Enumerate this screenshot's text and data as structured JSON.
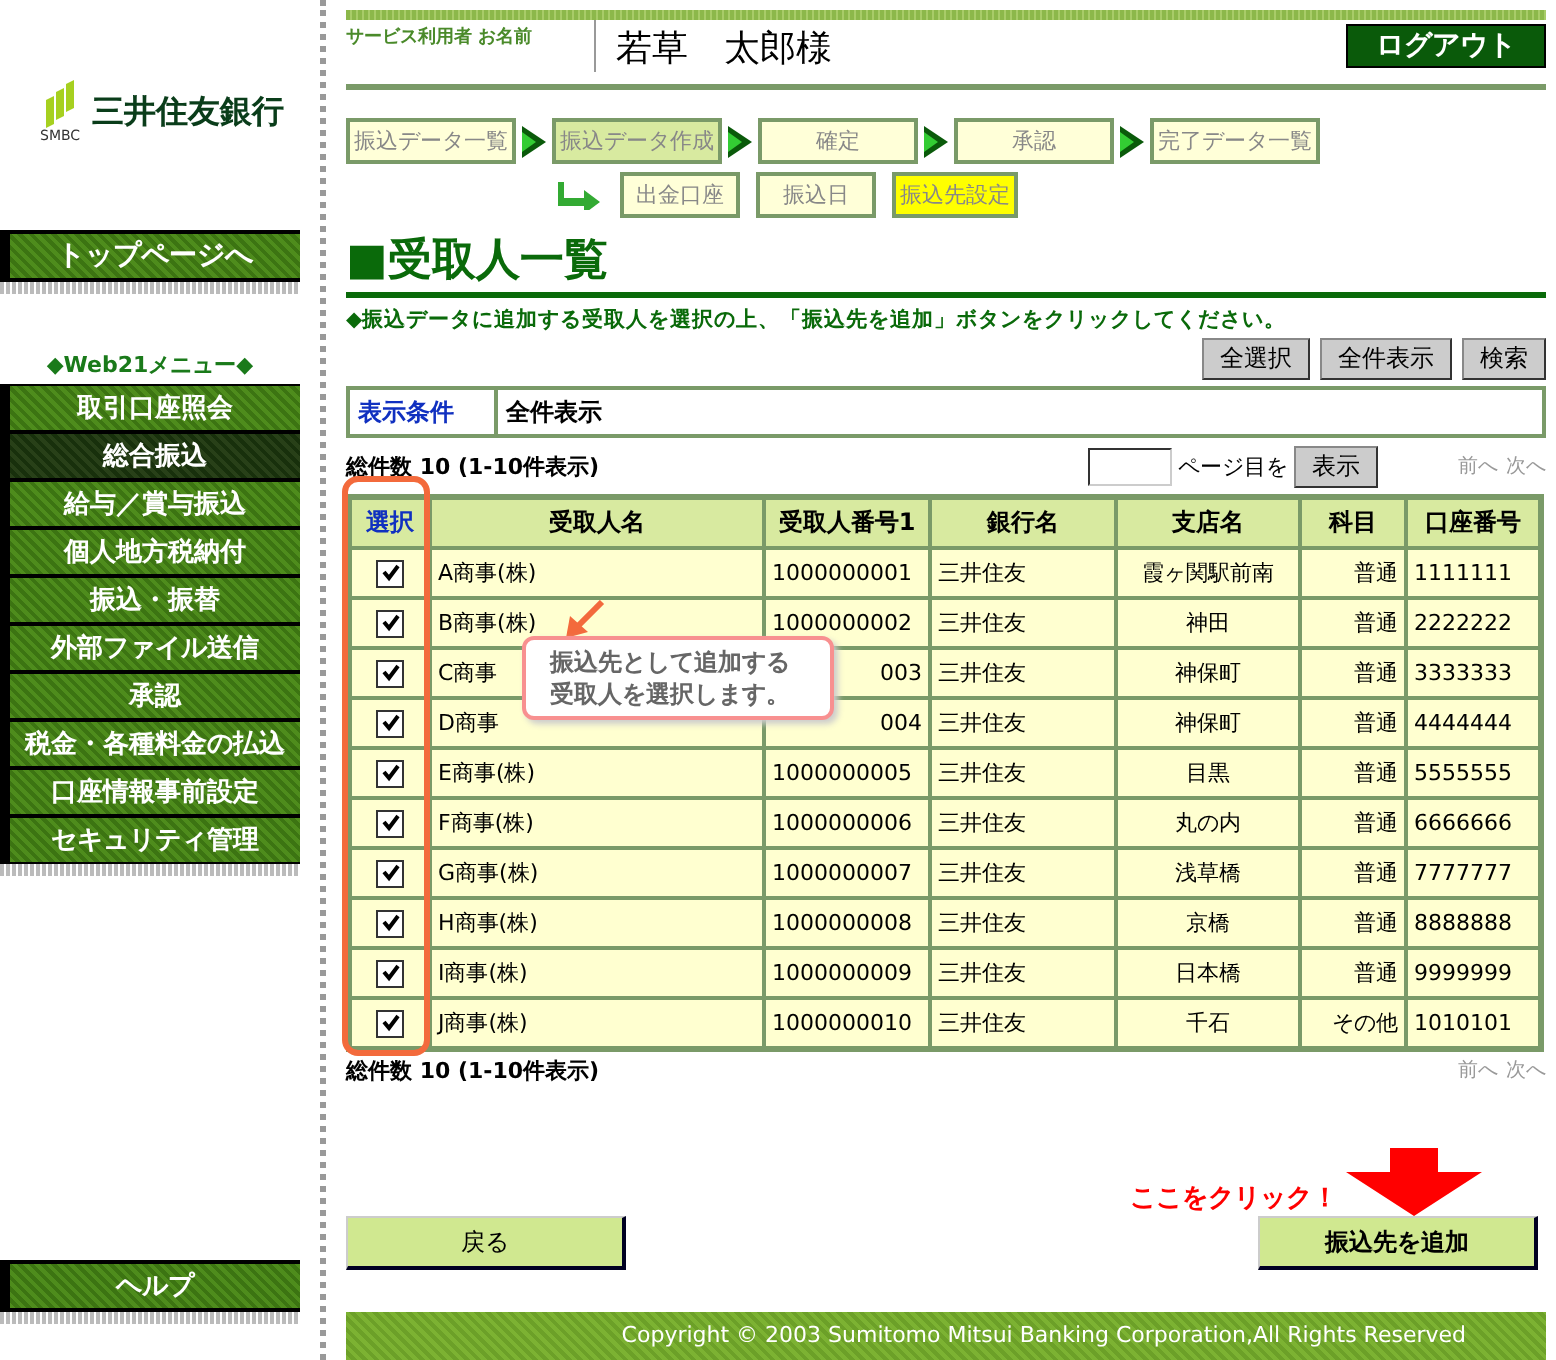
{
  "sidebar": {
    "logo_text": "三井住友銀行",
    "logo_sub": "SMBC",
    "top_button": "トップページへ",
    "menu_title": "◆Web21メニュー◆",
    "items": [
      {
        "label": "取引口座照会",
        "selected": false
      },
      {
        "label": "総合振込",
        "selected": true
      },
      {
        "label": "給与／賞与振込",
        "selected": false
      },
      {
        "label": "個人地方税納付",
        "selected": false
      },
      {
        "label": "振込・振替",
        "selected": false
      },
      {
        "label": "外部ファイル送信",
        "selected": false
      },
      {
        "label": "承認",
        "selected": false
      },
      {
        "label": "税金・各種料金の払込",
        "selected": false
      },
      {
        "label": "口座情報事前設定",
        "selected": false
      },
      {
        "label": "セキュリティ管理",
        "selected": false
      }
    ],
    "help_button": "ヘルプ"
  },
  "header": {
    "user_label": "サービス利用者 お名前",
    "user_name": "若草　太郎様",
    "logout": "ログアウト"
  },
  "steps": [
    {
      "label": "振込データ一覧",
      "selected": false
    },
    {
      "label": "振込データ作成",
      "selected": true
    },
    {
      "label": "確定",
      "selected": false
    },
    {
      "label": "承認",
      "selected": false
    },
    {
      "label": "完了データ一覧",
      "selected": false
    }
  ],
  "substeps": [
    {
      "label": "出金口座",
      "selected": false
    },
    {
      "label": "振込日",
      "selected": false
    },
    {
      "label": "振込先設定",
      "selected": true
    }
  ],
  "title": "■受取人一覧",
  "instruction": "◆振込データに追加する受取人を選択の上、「振込先を追加」ボタンをクリックしてください。",
  "toolbar": [
    "全選択",
    "全件表示",
    "検索"
  ],
  "condition": {
    "label": "表示条件",
    "value": "全件表示"
  },
  "count_text": "総件数 10 (1-10件表示)",
  "page_suffix": "ページ目を",
  "page_button": "表示",
  "pager": [
    "前へ",
    "次へ"
  ],
  "table": {
    "select_header": "選択",
    "columns": [
      "受取人名",
      "受取人番号1",
      "銀行名",
      "支店名",
      "科目",
      "口座番号"
    ],
    "rows": [
      {
        "checked": true,
        "covered": false,
        "cells": [
          "A商事(株)",
          "1000000001",
          "三井住友",
          "霞ヶ関駅前南",
          "普通",
          "1111111"
        ]
      },
      {
        "checked": true,
        "covered": false,
        "cells": [
          "B商事(株)",
          "1000000002",
          "三井住友",
          "神田",
          "普通",
          "2222222"
        ]
      },
      {
        "checked": true,
        "covered": true,
        "cells": [
          "C商事",
          "003",
          "三井住友",
          "神保町",
          "普通",
          "3333333"
        ]
      },
      {
        "checked": true,
        "covered": true,
        "cells": [
          "D商事",
          "004",
          "三井住友",
          "神保町",
          "普通",
          "4444444"
        ]
      },
      {
        "checked": true,
        "covered": false,
        "cells": [
          "E商事(株)",
          "1000000005",
          "三井住友",
          "目黒",
          "普通",
          "5555555"
        ]
      },
      {
        "checked": true,
        "covered": false,
        "cells": [
          "F商事(株)",
          "1000000006",
          "三井住友",
          "丸の内",
          "普通",
          "6666666"
        ]
      },
      {
        "checked": true,
        "covered": false,
        "cells": [
          "G商事(株)",
          "1000000007",
          "三井住友",
          "浅草橋",
          "普通",
          "7777777"
        ]
      },
      {
        "checked": true,
        "covered": false,
        "cells": [
          "H商事(株)",
          "1000000008",
          "三井住友",
          "京橋",
          "普通",
          "8888888"
        ]
      },
      {
        "checked": true,
        "covered": false,
        "cells": [
          "I商事(株)",
          "1000000009",
          "三井住友",
          "日本橋",
          "普通",
          "9999999"
        ]
      },
      {
        "checked": true,
        "covered": false,
        "cells": [
          "J商事(株)",
          "1000000010",
          "三井住友",
          "千石",
          "その他",
          "1010101"
        ]
      }
    ]
  },
  "bottom_count": "総件数 10 (1-10件表示)",
  "bottom_pager": [
    "前へ",
    "次へ"
  ],
  "callout": "振込先として追加する受取人を選択します。",
  "click_hint": "ここをクリック！",
  "back_button": "戻る",
  "add_button": "振込先を追加",
  "footer": "Copyright © 2003 Sumitomo Mitsui Banking Corporation,All Rights Reserved"
}
